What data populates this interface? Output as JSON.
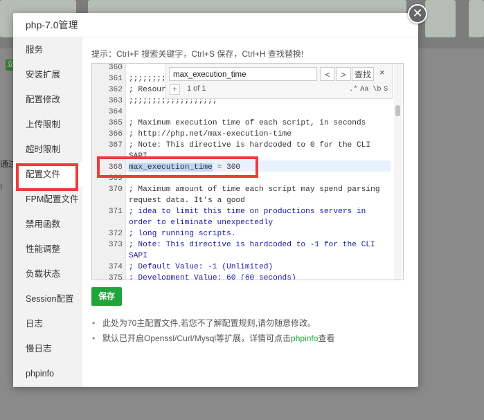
{
  "dialog": {
    "title": "php-7.0管理",
    "close_glyph": "✕"
  },
  "sidebar": {
    "items": [
      {
        "label": "服务"
      },
      {
        "label": "安装扩展"
      },
      {
        "label": "配置修改"
      },
      {
        "label": "上传限制"
      },
      {
        "label": "超时限制"
      },
      {
        "label": "配置文件",
        "active": true
      },
      {
        "label": "FPM配置文件"
      },
      {
        "label": "禁用函数"
      },
      {
        "label": "性能调整"
      },
      {
        "label": "负载状态"
      },
      {
        "label": "Session配置"
      },
      {
        "label": "日志"
      },
      {
        "label": "慢日志"
      },
      {
        "label": "phpinfo"
      }
    ]
  },
  "hint": "提示：Ctrl+F 搜索关键字，Ctrl+S 保存，Ctrl+H 查找替换!",
  "find": {
    "query": "max_execution_time",
    "prev": "<",
    "next": ">",
    "search_label": "查找",
    "close": "×",
    "plus": "+",
    "count": "1 of 1",
    "opt_regex": ".*",
    "opt_case": "Aa",
    "opt_word": "\\b",
    "opt_selection": "S"
  },
  "editor": {
    "lines": [
      {
        "n": "360",
        "text": ""
      },
      {
        "n": "361",
        "text": ";;;;;;;;"
      },
      {
        "n": "362",
        "text": "; Resour"
      },
      {
        "n": "363",
        "text": ";;;;;;;;;;;;;;;;;;;"
      },
      {
        "n": "364",
        "text": ""
      },
      {
        "n": "365",
        "text": "; Maximum execution time of each script, in seconds"
      },
      {
        "n": "366",
        "text": "; http://php.net/max-execution-time"
      },
      {
        "n": "367",
        "text": "; Note: This directive is hardcoded to 0 for the CLI"
      },
      {
        "n": "",
        "text": "  SAPI"
      },
      {
        "n": "368",
        "match": "max_execution_time",
        "rest": " = 300"
      },
      {
        "n": "369",
        "text": ""
      },
      {
        "n": "370",
        "text": "; Maximum amount of time each script may spend parsing"
      },
      {
        "n": "",
        "text": "  request data. It's a good"
      },
      {
        "n": "371",
        "text": "; idea to limit this time on productions servers in",
        "blue": true
      },
      {
        "n": "",
        "text": "  order to eliminate unexpectedly",
        "blue": true
      },
      {
        "n": "372",
        "text": "; long running scripts.",
        "blue": true
      },
      {
        "n": "373",
        "text": "; Note: This directive is hardcoded to -1 for the CLI",
        "blue": true
      },
      {
        "n": "",
        "text": "  SAPI",
        "blue": true
      },
      {
        "n": "374",
        "text": "; Default Value: -1 (Unlimited)",
        "blue": true
      },
      {
        "n": "375",
        "text": "; Development Value: 60 (60 seconds)",
        "blue": true
      }
    ]
  },
  "save_label": "保存",
  "notes": {
    "n1": "此处为70主配置文件,若您不了解配置规则,请勿随意修改。",
    "n2_pre": "默认已开启Openssl/Curl/Mysql等扩展，详情可点击",
    "n2_link": "phpinfo",
    "n2_post": "查看"
  },
  "background": {
    "green_badge": "立",
    "side_text1": "通过",
    "side_text2": "!"
  }
}
